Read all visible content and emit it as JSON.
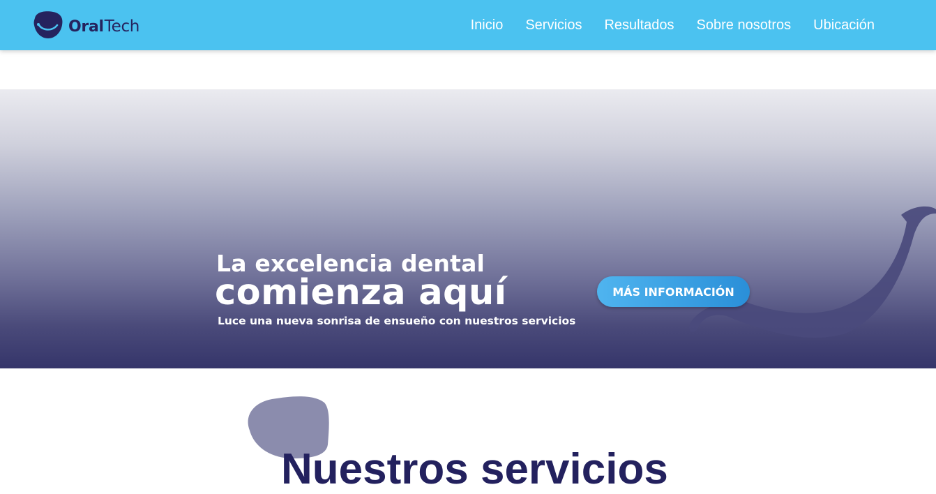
{
  "header": {
    "logo": {
      "icon": "tooth-smile-logo-icon",
      "word_bold": "Oral",
      "word_light": "Tech"
    },
    "nav": [
      {
        "label": "Inicio"
      },
      {
        "label": "Servicios"
      },
      {
        "label": "Resultados"
      },
      {
        "label": "Sobre nosotros"
      },
      {
        "label": "Ubicación"
      }
    ]
  },
  "hero": {
    "line1": "La excelencia dental",
    "line2": "comienza aquí",
    "subtitle": "Luce una nueva sonrisa de ensueño con nuestros servicios",
    "button_label": "MÁS INFORMACIÓN"
  },
  "services": {
    "title": "Nuestros servicios"
  },
  "colors": {
    "navbar": "#4bc2f0",
    "brand_dark": "#23215e",
    "button": "#3aa4e6",
    "hero_bottom": "#35356a"
  }
}
